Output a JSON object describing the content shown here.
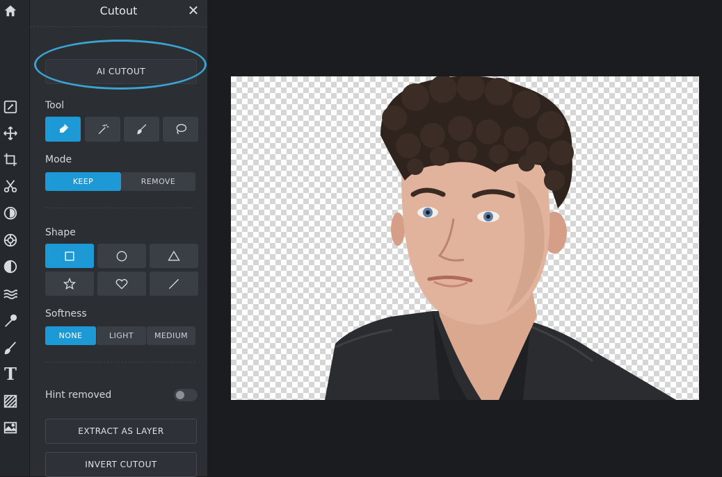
{
  "panel": {
    "title": "Cutout",
    "ai_cutout_label": "AI CUTOUT",
    "tool_label": "Tool",
    "mode_label": "Mode",
    "mode_options": [
      "KEEP",
      "REMOVE"
    ],
    "mode_selected": "KEEP",
    "shape_label": "Shape",
    "shape_options": [
      "square",
      "circle",
      "triangle",
      "star",
      "heart",
      "line"
    ],
    "shape_selected": "square",
    "softness_label": "Softness",
    "softness_options": [
      "NONE",
      "LIGHT",
      "MEDIUM"
    ],
    "softness_selected": "NONE",
    "hint_label": "Hint removed",
    "hint_enabled": false,
    "extract_label": "EXTRACT AS LAYER",
    "invert_label": "INVERT CUTOUT"
  },
  "tools": [
    "brush-cutout-icon",
    "magic-wand-icon",
    "brush-icon",
    "lasso-icon"
  ],
  "tool_selected": "brush-cutout-icon",
  "rail_icons": [
    "home-icon",
    "edit-icon",
    "move-icon",
    "crop-icon",
    "cut-icon",
    "adjust-icon",
    "effects-icon",
    "contrast-icon",
    "liquify-icon",
    "wand-icon",
    "brush-icon",
    "text-icon",
    "pattern-icon",
    "image-icon"
  ],
  "rail_text_icon": "T",
  "colors": {
    "accent": "#1d9ad6",
    "highlight_ring": "#3aa3cf"
  }
}
